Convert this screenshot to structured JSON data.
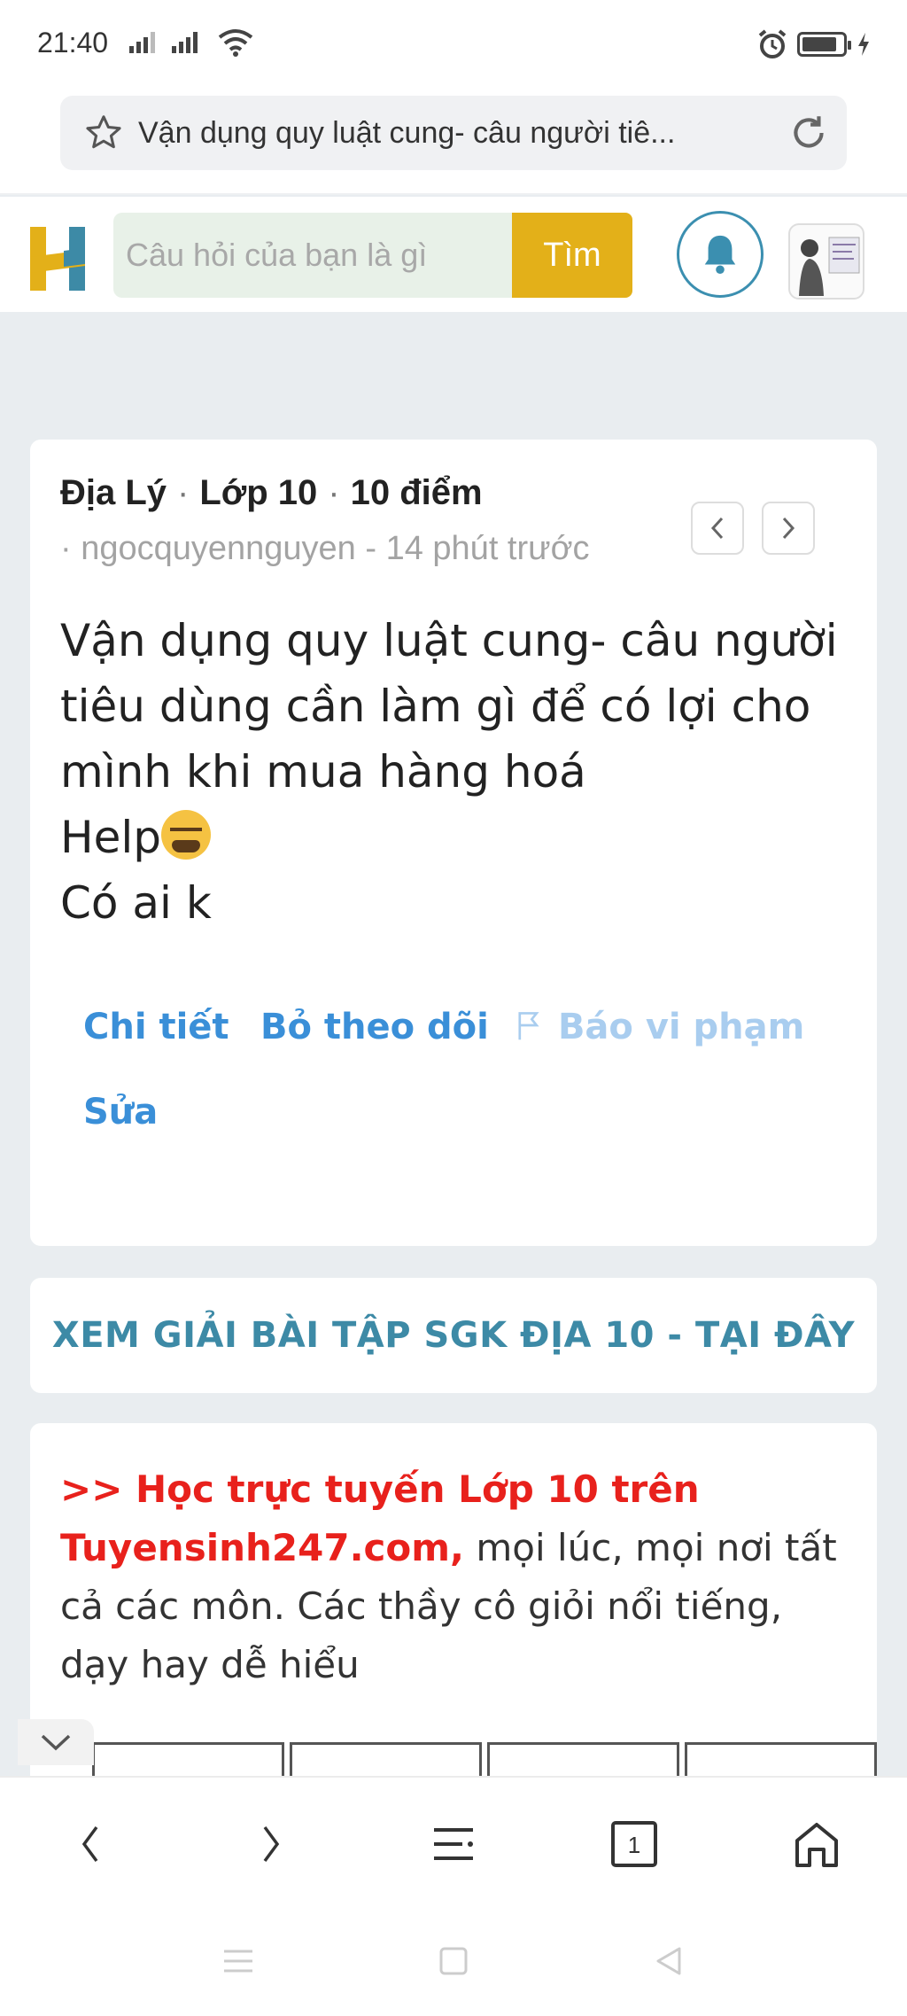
{
  "status_bar": {
    "time": "21:40",
    "icons": [
      "signal-icon",
      "signal-icon",
      "wifi-icon",
      "alarm-icon",
      "battery-icon",
      "charging-icon"
    ]
  },
  "browser": {
    "page_title": "Vận dụng quy luật cung- câu người tiê...",
    "icons": [
      "star-icon",
      "reload-icon"
    ]
  },
  "site_header": {
    "search_placeholder": "Câu hỏi của bạn là gì",
    "search_button": "Tìm",
    "icons": [
      "hoc24-logo",
      "bell-icon",
      "avatar"
    ]
  },
  "question": {
    "subject": "Địa Lý",
    "grade": "Lớp 10",
    "points": "10 điểm",
    "separator": "·",
    "author_line": "· ngocquyennguyen - 14 phút trước",
    "body_lines": [
      "Vận dụng quy luật cung- câu người",
      "tiêu dùng cần làm gì để có lợi cho",
      "mình khi mua hàng hoá",
      "Help",
      "Có ai k"
    ],
    "emoji": "crying-face-emoji",
    "actions": {
      "detail": "Chi tiết",
      "unfollow": "Bỏ theo dõi",
      "report": "Báo vi phạm",
      "edit": "Sửa"
    }
  },
  "sgk_banner": {
    "label": "XEM GIẢI BÀI TẬP SGK ĐỊA 10 - TẠI ĐÂY"
  },
  "promo": {
    "red_text": ">> Học trực tuyến Lớp 10 trên Tuyensinh247.com,",
    "text": " mọi lúc, mọi nơi tất cả các môn. Các thầy cô giỏi nổi tiếng, dạy hay dễ hiểu"
  },
  "toolbar": {
    "tab_count": "1",
    "icons": [
      "back-icon",
      "forward-icon",
      "menu-icon",
      "tabs-icon",
      "home-icon"
    ]
  },
  "colors": {
    "accent_yellow": "#e3b019",
    "link_blue": "#3a8fd8",
    "teal": "#3d8aa6",
    "promo_red": "#e8211c",
    "page_bg": "#e9edf0"
  }
}
